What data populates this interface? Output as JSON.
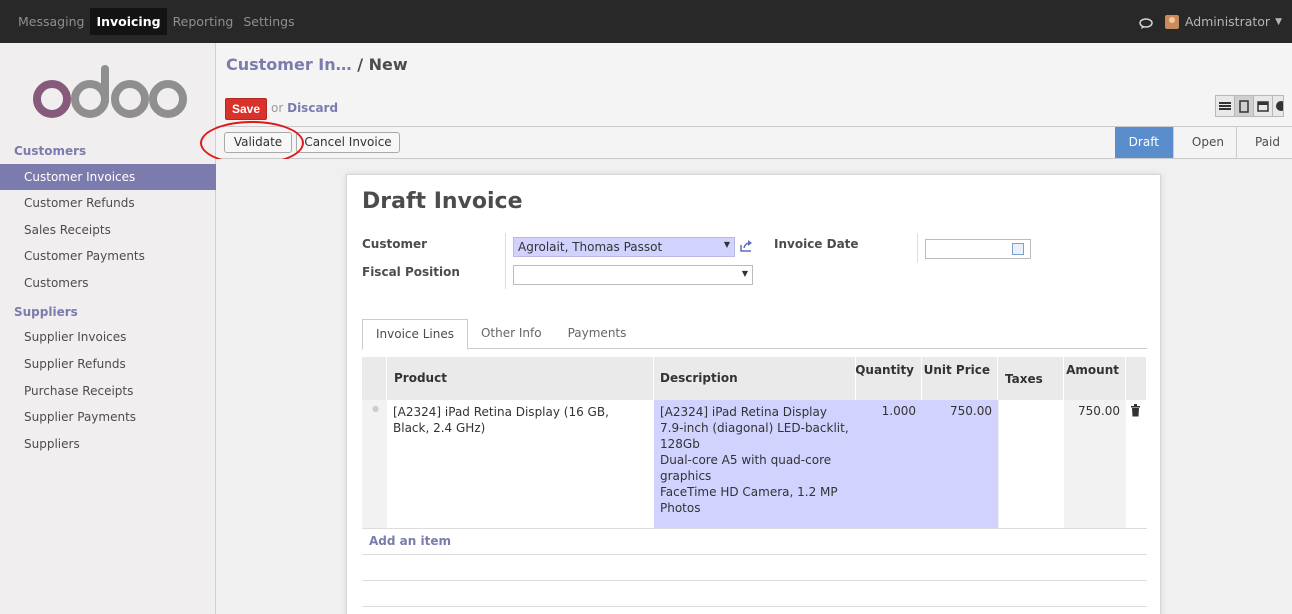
{
  "topbar": {
    "menu": [
      "Messaging",
      "Invoicing",
      "Reporting",
      "Settings"
    ],
    "active": "Invoicing",
    "user": "Administrator"
  },
  "logo": "odoo",
  "sidebar": {
    "customers_title": "Customers",
    "customers_items": [
      "Customer Invoices",
      "Customer Refunds",
      "Sales Receipts",
      "Customer Payments",
      "Customers"
    ],
    "suppliers_title": "Suppliers",
    "suppliers_items": [
      "Supplier Invoices",
      "Supplier Refunds",
      "Purchase Receipts",
      "Supplier Payments",
      "Suppliers"
    ]
  },
  "breadcrumb": {
    "parent": "Customer In…",
    "current": "/ New"
  },
  "toolbar": {
    "save": "Save",
    "or": "or",
    "discard": "Discard"
  },
  "statusbar": {
    "validate": "Validate",
    "cancel": "Cancel Invoice",
    "states": [
      "Draft",
      "Open",
      "Paid"
    ],
    "active_state": "Draft"
  },
  "sheet": {
    "title": "Draft Invoice",
    "customer_label": "Customer",
    "customer_value": "Agrolait, Thomas Passot",
    "fiscal_label": "Fiscal Position",
    "fiscal_value": "",
    "date_label": "Invoice Date",
    "date_value": ""
  },
  "tabs": [
    "Invoice Lines",
    "Other Info",
    "Payments"
  ],
  "lines": {
    "headers": {
      "product": "Product",
      "description": "Description",
      "quantity": "Quantity",
      "unit_price": "Unit Price",
      "taxes": "Taxes",
      "amount": "Amount"
    },
    "rows": [
      {
        "product": "[A2324] iPad Retina Display (16 GB, Black, 2.4 GHz)",
        "description": [
          "[A2324] iPad Retina Display",
          "7.9-inch (diagonal) LED-backlit,",
          "128Gb",
          "Dual-core A5 with quad-core",
          "graphics",
          "FaceTime HD Camera, 1.2 MP",
          "Photos"
        ],
        "quantity": "1.000",
        "unit_price": "750.00",
        "taxes": "",
        "amount": "750.00"
      }
    ],
    "add_item": "Add an item"
  },
  "colors": {
    "accent": "#7c7bad",
    "save": "#d9322b",
    "state_active": "#5a8dcc",
    "topbar": "#282828"
  }
}
